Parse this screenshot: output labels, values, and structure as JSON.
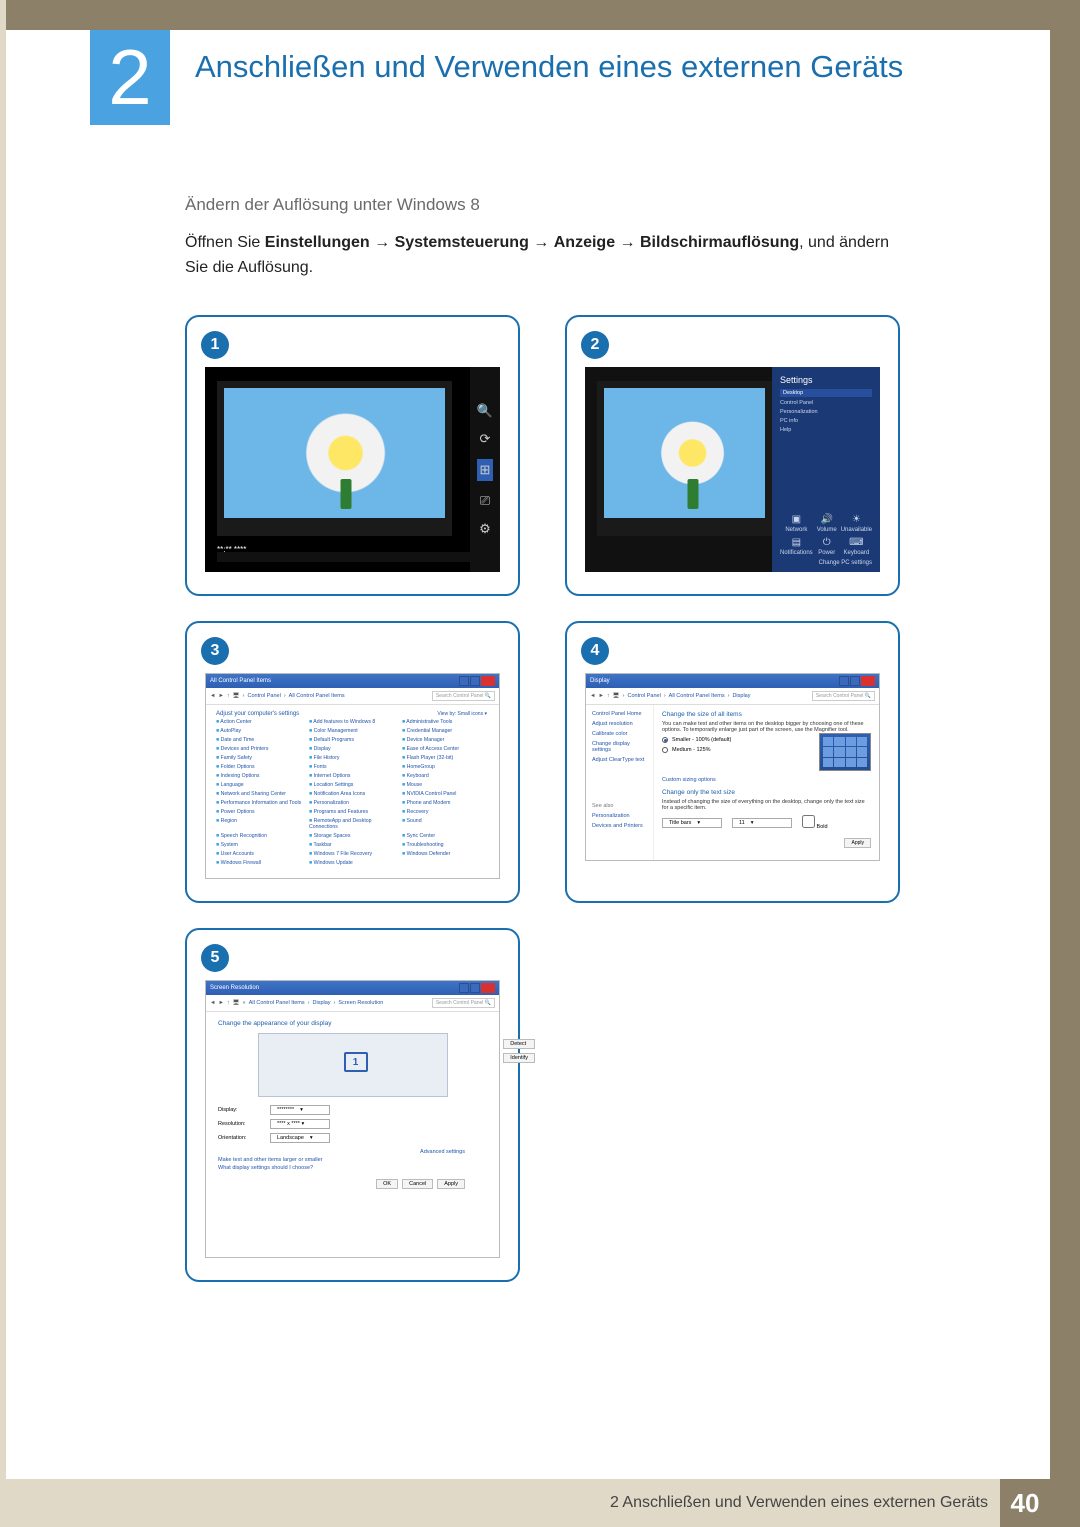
{
  "chapter": {
    "number": "2",
    "title": "Anschließen und Verwenden eines externen Geräts"
  },
  "section": {
    "subhead": "Ändern der Auflösung unter Windows 8",
    "body_pre": "Öffnen Sie ",
    "path": {
      "a": "Einstellungen",
      "b": "Systemsteuerung",
      "c": "Anzeige",
      "d": "Bildschirmauflösung"
    },
    "arrow": "→",
    "body_post": ", und ändern Sie die Auflösung."
  },
  "badges": {
    "b1": "1",
    "b2": "2",
    "b3": "3",
    "b4": "4",
    "b5": "5"
  },
  "fig1": {
    "time_line1": "**:**   ****",
    "time_line2": "**** **"
  },
  "fig2": {
    "settings_title": "Settings",
    "items": {
      "i0": "Desktop",
      "i1": "Control Panel",
      "i2": "Personalization",
      "i3": "PC info",
      "i4": "Help"
    },
    "tiles": {
      "t0": "Network",
      "t1": "Volume",
      "t2": "Unavailable",
      "t3": "Notifications",
      "t4": "Power",
      "t5": "Keyboard"
    },
    "change_pc": "Change PC settings"
  },
  "fig3": {
    "title": "All Control Panel Items",
    "crumbs": {
      "c1": "Control Panel",
      "c2": "All Control Panel Items"
    },
    "search_ph": "Search Control Panel",
    "adjust": "Adjust your computer's settings",
    "viewby": "View by:   Small icons ▾",
    "items": [
      "Action Center",
      "Add features to Windows 8",
      "Administrative Tools",
      "AutoPlay",
      "Color Management",
      "Credential Manager",
      "Date and Time",
      "Default Programs",
      "Device Manager",
      "Devices and Printers",
      "Display",
      "Ease of Access Center",
      "Family Safety",
      "File History",
      "Flash Player (32-bit)",
      "Folder Options",
      "Fonts",
      "HomeGroup",
      "Indexing Options",
      "Internet Options",
      "Keyboard",
      "Language",
      "Location Settings",
      "Mouse",
      "Network and Sharing Center",
      "Notification Area Icons",
      "NVIDIA Control Panel",
      "Performance Information and Tools",
      "Personalization",
      "Phone and Modem",
      "Power Options",
      "Programs and Features",
      "Recovery",
      "Region",
      "RemoteApp and Desktop Connections",
      "Sound",
      "Speech Recognition",
      "Storage Spaces",
      "Sync Center",
      "System",
      "Taskbar",
      "Troubleshooting",
      "User Accounts",
      "Windows 7 File Recovery",
      "Windows Defender",
      "Windows Firewall",
      "Windows Update",
      ""
    ]
  },
  "fig4": {
    "title": "Display",
    "crumbs": {
      "c1": "Control Panel",
      "c2": "All Control Panel Items",
      "c3": "Display"
    },
    "search_ph": "Search Control Panel",
    "side": {
      "s0": "Control Panel Home",
      "s1": "Adjust resolution",
      "s2": "Calibrate color",
      "s3": "Change display settings",
      "s4": "Adjust ClearType text"
    },
    "head1": "Change the size of all items",
    "para1": "You can make text and other items on the desktop bigger by choosing one of these options. To temporarily enlarge just part of the screen, use the Magnifier tool.",
    "opt1": "Smaller - 100% (default)",
    "opt2": "Medium - 125%",
    "custom": "Custom sizing options",
    "head2": "Change only the text size",
    "para2": "Instead of changing the size of everything on the desktop, change only the text size for a specific item.",
    "title_bars": "Title bars",
    "size": "11",
    "bold": "Bold",
    "apply": "Apply",
    "seealso": "See also",
    "see1": "Personalization",
    "see2": "Devices and Printers"
  },
  "fig5": {
    "title": "Screen Resolution",
    "crumbs": {
      "c1": "All Control Panel Items",
      "c2": "Display",
      "c3": "Screen Resolution"
    },
    "search_ph": "Search Control Panel",
    "head": "Change the appearance of your display",
    "mon": "1",
    "detect": "Detect",
    "identify": "Identify",
    "display_lbl": "Display:",
    "display_val": "********",
    "res_lbl": "Resolution:",
    "res_val": "**** x **** ▾",
    "orient_lbl": "Orientation:",
    "orient_val": "Landscape",
    "adv": "Advanced settings",
    "link1": "Make text and other items larger or smaller",
    "link2": "What display settings should I choose?",
    "ok": "OK",
    "cancel": "Cancel",
    "apply": "Apply"
  },
  "footer": {
    "text": "2 Anschließen und Verwenden eines externen Geräts",
    "page": "40"
  }
}
